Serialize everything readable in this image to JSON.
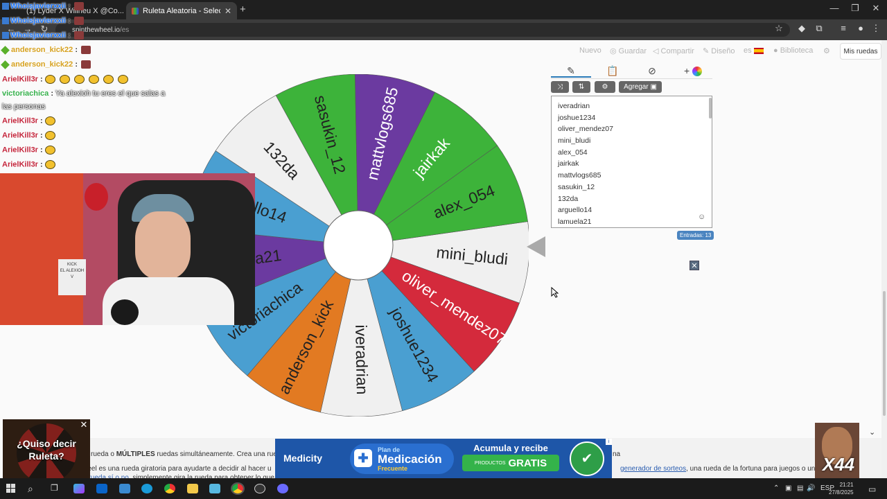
{
  "browser": {
    "tabs": [
      {
        "label": "(1) Lyder X Willneu X @Co..."
      },
      {
        "label": "Ruleta Aleatoria - Selector Pers..."
      }
    ],
    "new_tab": "+",
    "url_domain": "spinthewheel.io",
    "url_path": "/es",
    "window_controls": {
      "minimize": "—",
      "restore": "❐",
      "close": "✕"
    }
  },
  "site_nav": {
    "nuevo": "Nuevo",
    "guardar": "Guardar",
    "compartir": "Compartir",
    "diseno": "Diseño",
    "lang": "es",
    "biblioteca": "Biblioteca",
    "mis_ruedas": "Mis ruedas"
  },
  "editor": {
    "agregar": "Agregar",
    "entries": [
      "iveradrian",
      "joshue1234",
      "oliver_mendez07",
      "mini_bludi",
      "alex_054",
      "jairkak",
      "mattvlogs685",
      "sasukin_12",
      "132da",
      "arguello14",
      "lamuela21"
    ],
    "count_label": "Entradas: 13",
    "close": "✕"
  },
  "wheel": {
    "segments": [
      {
        "label": "mini_bludi",
        "color": "#f0f0f0",
        "text_color": "#222222"
      },
      {
        "label": "oliver_mendez07",
        "color": "#d42a3c",
        "text_color": "#ffffff"
      },
      {
        "label": "joshue1234",
        "color": "#4a9fd1",
        "text_color": "#222222"
      },
      {
        "label": "iveradrian",
        "color": "#f0f0f0",
        "text_color": "#222222"
      },
      {
        "label": "anderson_kick",
        "color": "#e27a22",
        "text_color": "#222222"
      },
      {
        "label": "victoriachica",
        "color": "#4a9fd1",
        "text_color": "#222222"
      },
      {
        "label": "lamuela21",
        "color": "#6b3aa0",
        "text_color": "#222222"
      },
      {
        "label": "arguello14",
        "color": "#4a9fd1",
        "text_color": "#222222"
      },
      {
        "label": "132da",
        "color": "#f0f0f0",
        "text_color": "#222222"
      },
      {
        "label": "sasukin_12",
        "color": "#3db33a",
        "text_color": "#222222"
      },
      {
        "label": "mattvlogs685",
        "color": "#6b3aa0",
        "text_color": "#ffffff"
      },
      {
        "label": "jairkak",
        "color": "#3db33a",
        "text_color": "#ffffff"
      },
      {
        "label": "alex_054",
        "color": "#3db33a",
        "text_color": "#222222"
      }
    ]
  },
  "description": {
    "l1_pre": "rueda o ",
    "l1_bold": "MÚLTIPLES",
    "l1_post": " ruedas simultáneamente. Crea una rueda pe",
    "l1_tail": "na",
    "l2_pre": "e Wheel es una rueda giratoria para ayudarte a decidir al hacer u",
    "l2_link": "generador de sorteos",
    "l2_post": ", una rueda de la fortuna para juegos o una",
    "l3_pre": "mple ",
    "l3_link": "rueda sí o no",
    "l3_post": ", simplemente gira la rueda para obtener lo que nec"
  },
  "ad": {
    "brand": "Medicity",
    "plan_top": "Plan de",
    "plan_big": "Medicación",
    "plan_sub": "Frecuente",
    "right_l1": "Acumula y recibe",
    "right_small": "PRODUCTOS",
    "right_big": "GRATIS",
    "corner": "i"
  },
  "chat": [
    {
      "user": "Whoisjavierxxii",
      "msg": "",
      "color": "#1e78ff",
      "type": "sub"
    },
    {
      "user": "Whoisjavierxxii",
      "msg": "",
      "color": "#1e78ff",
      "type": "sub"
    },
    {
      "user": "Whoisjavierxxii",
      "msg": "",
      "color": "#1e78ff",
      "type": "sub"
    },
    {
      "user": "anderson_kick22",
      "msg": "",
      "color": "#d6a11f",
      "type": "gem"
    },
    {
      "user": "anderson_kick22",
      "msg": "",
      "color": "#d6a11f",
      "type": "gem"
    },
    {
      "user": "ArielKill3r",
      "msg": "",
      "color": "#c3243a",
      "type": "pepe5"
    },
    {
      "user": "victoriachica",
      "msg": "Ya alexioh tu eres el que salas a",
      "color": "#37b24d",
      "type": "text"
    },
    {
      "user": "",
      "msg": "las personas",
      "color": "#37b24d",
      "type": "cont"
    },
    {
      "user": "ArielKill3r",
      "msg": "",
      "color": "#c3243a",
      "type": "pepe"
    },
    {
      "user": "ArielKill3r",
      "msg": "",
      "color": "#c3243a",
      "type": "pepe"
    },
    {
      "user": "ArielKill3r",
      "msg": "",
      "color": "#c3243a",
      "type": "pepe"
    },
    {
      "user": "ArielKill3r",
      "msg": "",
      "color": "#c3243a",
      "type": "pepe"
    }
  ],
  "webcam": {
    "sign": "KICK\nEL ALEXIOH\nV"
  },
  "popup": {
    "text": "¿Quiso decir Ruleta?",
    "close": "✕"
  },
  "meme": {
    "text": "X44"
  },
  "taskbar": {
    "lang": "ESP",
    "time": "21:21",
    "date": "27/8/2025"
  }
}
